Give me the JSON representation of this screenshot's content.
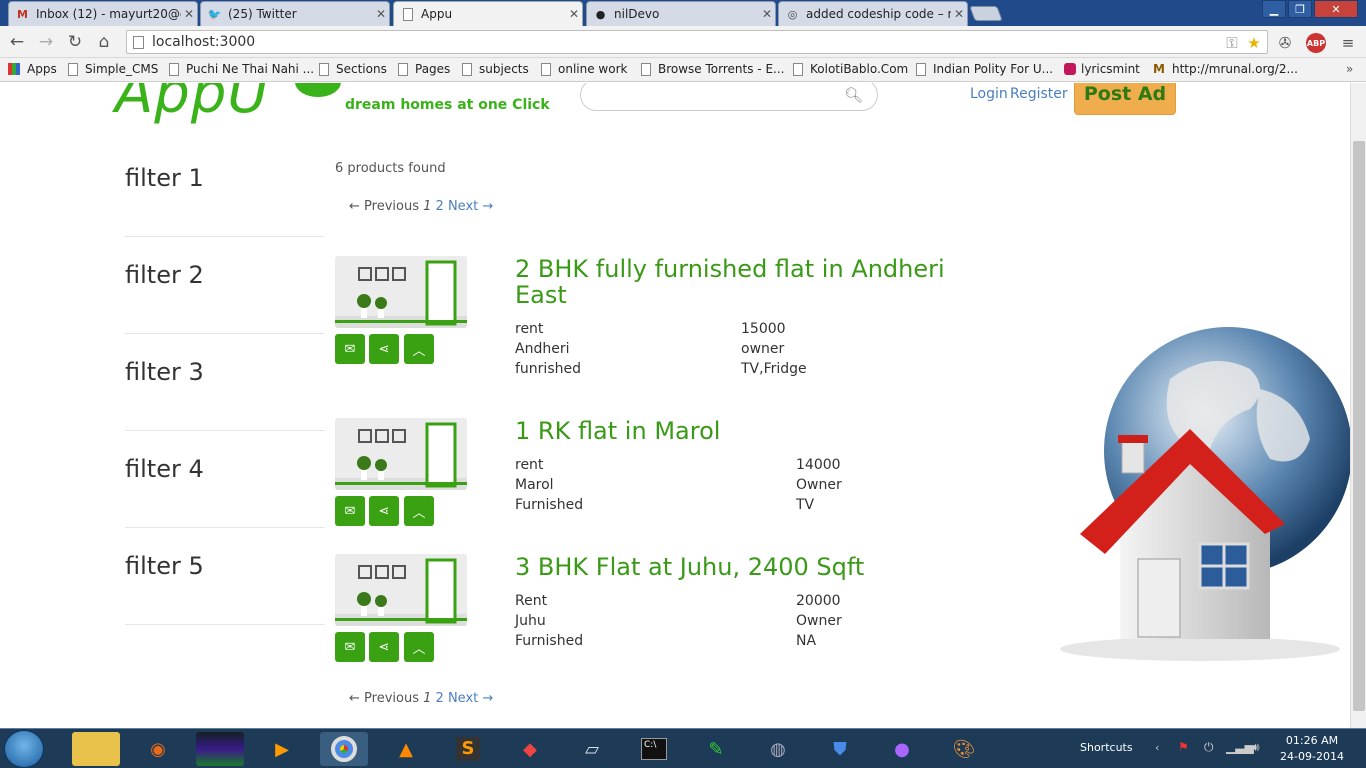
{
  "browser": {
    "tabs": [
      {
        "title": "Inbox (12) - mayurt20@g",
        "icon": "gmail-icon",
        "icon_color": "#c5321f"
      },
      {
        "title": "(25) Twitter",
        "icon": "twitter-icon",
        "icon_color": "#3a9ee6"
      },
      {
        "title": "Appu",
        "icon": "page-icon",
        "icon_color": "#888888"
      },
      {
        "title": "nilDevo",
        "icon": "github-icon",
        "icon_color": "#222222"
      },
      {
        "title": "added codeship code – ni",
        "icon": "codeship-icon",
        "icon_color": "#444444"
      }
    ],
    "url": "localhost:3000",
    "bookmarks": [
      {
        "label": "Apps"
      },
      {
        "label": "Simple_CMS"
      },
      {
        "label": "Puchi Ne Thai Nahi ..."
      },
      {
        "label": "Sections"
      },
      {
        "label": "Pages"
      },
      {
        "label": "subjects"
      },
      {
        "label": "online work"
      },
      {
        "label": "Browse Torrents - E..."
      },
      {
        "label": "KolotiBablo.Com"
      },
      {
        "label": "Indian Polity For U..."
      },
      {
        "label": "lyricsmint"
      },
      {
        "label": "http://mrunal.org/2..."
      }
    ]
  },
  "site": {
    "logo": "AppU",
    "tagline": "dream homes at one Click",
    "search_placeholder": "",
    "login": "Login",
    "register": "Register",
    "post_ad": "Post Ad",
    "accent_color": "#3a9a18"
  },
  "filters": [
    "filter 1",
    "filter 2",
    "filter 3",
    "filter 4",
    "filter 5"
  ],
  "results": {
    "count_text": "6 products found",
    "pager": {
      "prev": "← Previous",
      "current": "1",
      "page2": "2",
      "next": "Next →"
    }
  },
  "listings": [
    {
      "title": "2 BHK fully furnished flat in Andheri East",
      "rows": [
        [
          "rent",
          "15000"
        ],
        [
          "Andheri",
          "owner"
        ],
        [
          "funrished",
          "TV,Fridge"
        ]
      ]
    },
    {
      "title": "1 RK flat in Marol",
      "rows": [
        [
          "rent",
          "14000"
        ],
        [
          "Marol",
          "Owner"
        ],
        [
          "Furnished",
          "TV"
        ]
      ]
    },
    {
      "title": "3 BHK Flat at Juhu, 2400 Sqft",
      "rows": [
        [
          "Rent",
          "20000"
        ],
        [
          "Juhu",
          "Owner"
        ],
        [
          "Furnished",
          "NA"
        ]
      ]
    }
  ],
  "taskbar": {
    "shortcuts": "Shortcuts",
    "time": "01:26 AM",
    "date": "24-09-2014"
  }
}
